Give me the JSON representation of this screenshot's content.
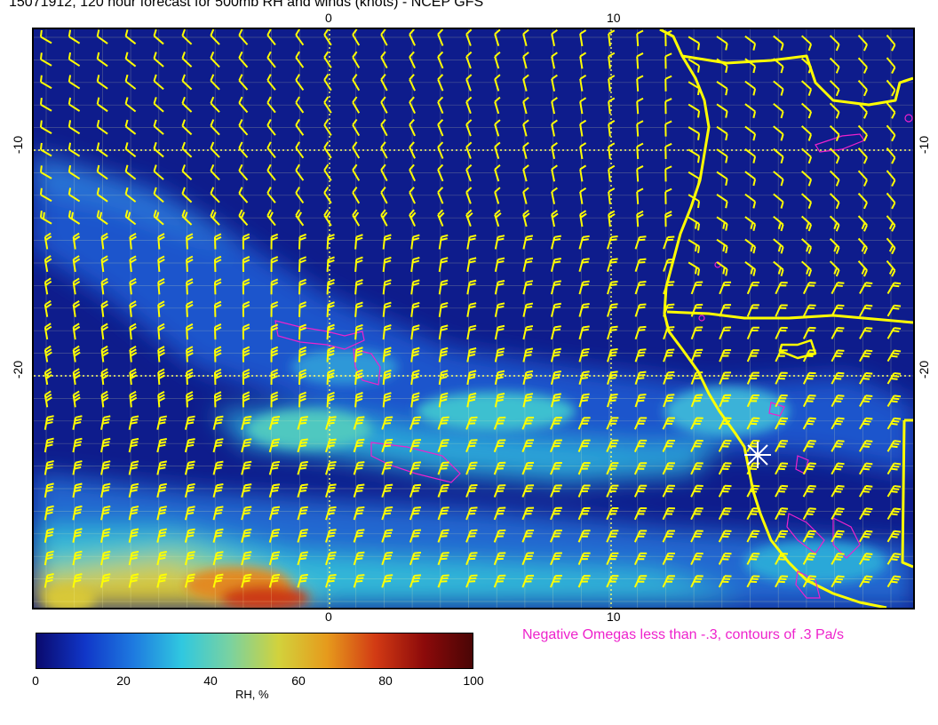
{
  "title": "15071912, 120 hour forecast for 500mb RH and winds (knots) - NCEP GFS",
  "lon_ticks_top": [
    "0",
    "10"
  ],
  "lon_ticks_bottom": [
    "0",
    "10"
  ],
  "lat_ticks_left": [
    "-10",
    "-20"
  ],
  "lat_ticks_right": [
    "-10",
    "-20"
  ],
  "omega_note": "Negative Omegas less than -.3, contours of .3 Pa/s",
  "colorbar": {
    "label": "RH, %",
    "ticks": [
      "0",
      "20",
      "40",
      "60",
      "80",
      "100"
    ],
    "range": [
      0,
      100
    ],
    "stops": [
      "#0a0a6e",
      "#1036c8",
      "#1e7ae0",
      "#30c8e0",
      "#7ad2a0",
      "#d2d23c",
      "#e69a1c",
      "#d23a14",
      "#8c0a0a",
      "#4a0505"
    ]
  },
  "colors": {
    "wind_barbs": "#ffff00",
    "coastline": "#ffff00",
    "omega_contours": "#ee22cc",
    "grid": "#ffff99",
    "station_marker": "#ffffff"
  },
  "wind_barb_icon": "wind-barb-icon",
  "station_icon": "star-marker-icon"
}
